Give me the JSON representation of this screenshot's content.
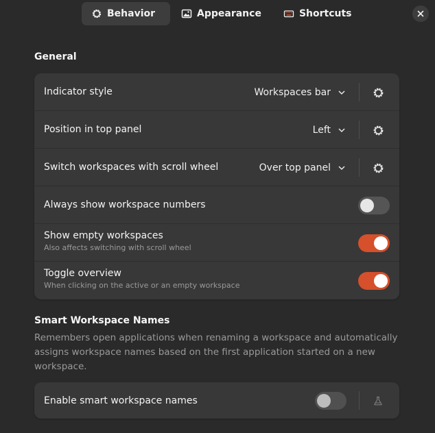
{
  "tabs": [
    {
      "label": "Behavior",
      "icon": "gear-icon",
      "active": true
    },
    {
      "label": "Appearance",
      "icon": "image-icon",
      "active": false
    },
    {
      "label": "Shortcuts",
      "icon": "keyboard-icon",
      "active": false
    }
  ],
  "colors": {
    "background": "#2a2a2a",
    "card": "#383838",
    "accent": "#d5502b",
    "secondary_text": "#9a9a9a"
  },
  "general": {
    "title": "General",
    "rows": [
      {
        "title": "Indicator style",
        "value": "Workspaces bar"
      },
      {
        "title": "Position in top panel",
        "value": "Left"
      },
      {
        "title": "Switch workspaces with scroll wheel",
        "value": "Over top panel"
      },
      {
        "title": "Always show workspace numbers",
        "toggle": false
      },
      {
        "title": "Show empty workspaces",
        "subtitle": "Also affects switching with scroll wheel",
        "toggle": true
      },
      {
        "title": "Toggle overview",
        "subtitle": "When clicking on the active or an empty workspace",
        "toggle": true
      }
    ]
  },
  "smart": {
    "title": "Smart Workspace Names",
    "description": "Remembers open applications when renaming a workspace and automatically assigns workspace names based on the first application started on a new workspace.",
    "rows": [
      {
        "title": "Enable smart workspace names",
        "toggle": false
      }
    ]
  }
}
